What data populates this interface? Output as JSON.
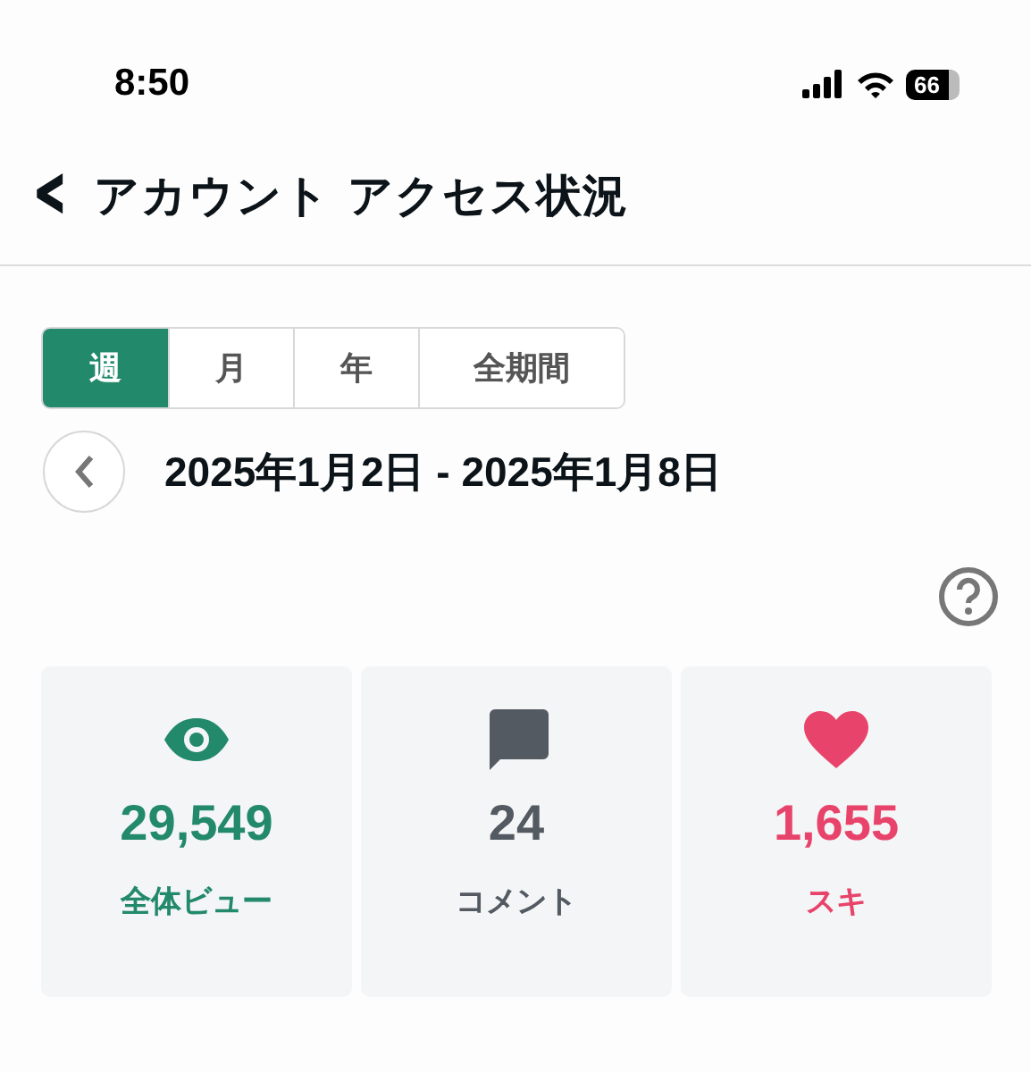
{
  "status_bar": {
    "time": "8:50",
    "battery": "66"
  },
  "header": {
    "back_icon": "‹",
    "title": "アカウント アクセス状況"
  },
  "tabs": [
    {
      "label": "週",
      "selected": true
    },
    {
      "label": "月",
      "selected": false
    },
    {
      "label": "年",
      "selected": false
    },
    {
      "label": "全期間",
      "selected": false
    }
  ],
  "date_range": "2025年1月2日 - 2025年1月8日",
  "stats": [
    {
      "kind": "views",
      "value": "29,549",
      "label": "全体ビュー",
      "color": "#22896b"
    },
    {
      "kind": "comments",
      "value": "24",
      "label": "コメント",
      "color": "#535a62"
    },
    {
      "kind": "likes",
      "value": "1,655",
      "label": "スキ",
      "color": "#e8436a"
    }
  ]
}
